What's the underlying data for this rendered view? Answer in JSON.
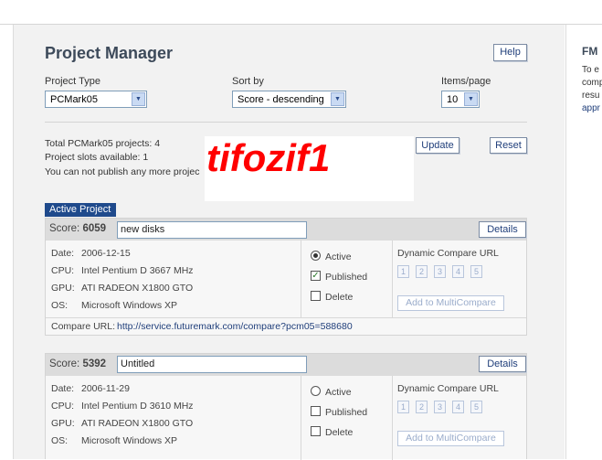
{
  "title": "Project Manager",
  "help_label": "Help",
  "filters": {
    "project_type_label": "Project Type",
    "project_type_value": "PCMark05",
    "sort_label": "Sort by",
    "sort_value": "Score - descending",
    "items_label": "Items/page",
    "items_value": "10"
  },
  "summary": {
    "total": "Total PCMark05 projects: 4",
    "slots": "Project slots available: 1",
    "publish_note": "You can not publish any more projec"
  },
  "update_label": "Update",
  "reset_label": "Reset",
  "watermark": "tifozif1",
  "active_project_label": "Active Project",
  "projects": [
    {
      "score_label": "Score:",
      "score": "6059",
      "name": "new disks",
      "details_label": "Details",
      "date": "2006-12-15",
      "cpu": "Intel Pentium D 3667 MHz",
      "gpu": "ATI RADEON X1800 GTO",
      "os": "Microsoft Windows XP",
      "active_label": "Active",
      "active": true,
      "published_label": "Published",
      "published": true,
      "delete_label": "Delete",
      "delete": false,
      "compare_title": "Dynamic Compare URL",
      "compare_numbers": [
        "1",
        "2",
        "3",
        "4",
        "5"
      ],
      "add_multi_label": "Add to MultiCompare",
      "compare_url_label": "Compare URL:",
      "compare_url": "http://service.futuremark.com/compare?pcm05=588680"
    },
    {
      "score_label": "Score:",
      "score": "5392",
      "name": "Untitled",
      "details_label": "Details",
      "date": "2006-11-29",
      "cpu": "Intel Pentium D 3610 MHz",
      "gpu": "ATI RADEON X1800 GTO",
      "os": "Microsoft Windows XP",
      "active_label": "Active",
      "active": false,
      "published_label": "Published",
      "published": false,
      "delete_label": "Delete",
      "delete": false,
      "compare_title": "Dynamic Compare URL",
      "compare_numbers": [
        "1",
        "2",
        "3",
        "4",
        "5"
      ],
      "add_multi_label": "Add to MultiCompare"
    }
  ],
  "labels": {
    "date": "Date:",
    "cpu": "CPU:",
    "gpu": "GPU:",
    "os": "OS:"
  },
  "right_panel": {
    "title": "FM",
    "lines": [
      "To e",
      "comp",
      "resu",
      "appr"
    ]
  }
}
